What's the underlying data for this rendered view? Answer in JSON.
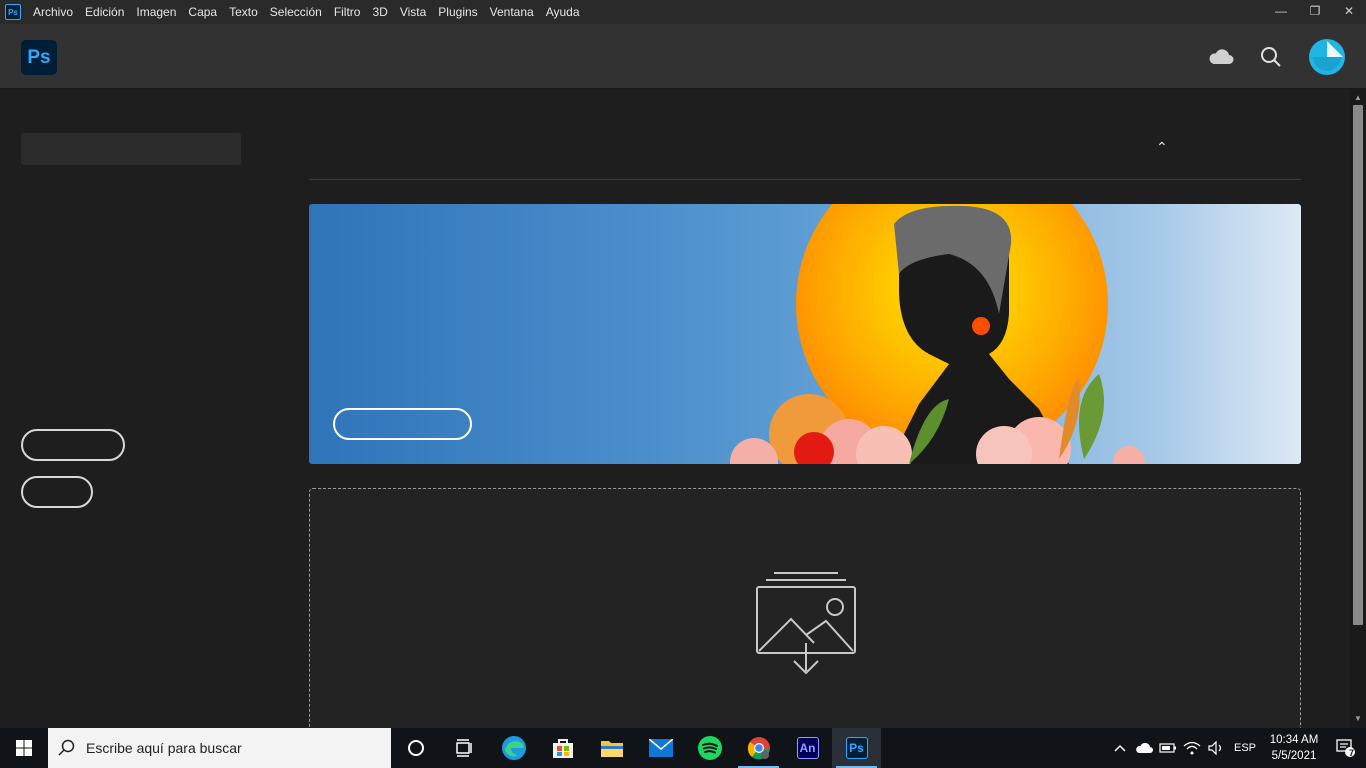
{
  "window": {
    "app_icon_label": "Ps",
    "menu": [
      "Archivo",
      "Edición",
      "Imagen",
      "Capa",
      "Texto",
      "Selección",
      "Filtro",
      "3D",
      "Vista",
      "Plugins",
      "Ventana",
      "Ayuda"
    ],
    "controls": {
      "minimize": "—",
      "restore": "❐",
      "close": "✕"
    }
  },
  "header": {
    "logo": "Ps",
    "icons": [
      "cloud-icon",
      "search-icon",
      "avatar"
    ]
  },
  "main": {
    "collapse_chevron": "⌃"
  },
  "taskbar": {
    "search_placeholder": "Escribe aquí para buscar",
    "apps": [
      "cortana",
      "task-view",
      "edge",
      "store",
      "file-explorer",
      "mail",
      "spotify",
      "chrome",
      "animate",
      "photoshop"
    ],
    "animate_label": "An",
    "photoshop_label": "Ps",
    "tray": {
      "language": "ESP",
      "time": "10:34 AM",
      "date": "5/5/2021",
      "notification_count": "7"
    }
  },
  "colors": {
    "accent": "#31a8ff",
    "ps_dark": "#001e36",
    "avatar": "#1fb6e6"
  }
}
